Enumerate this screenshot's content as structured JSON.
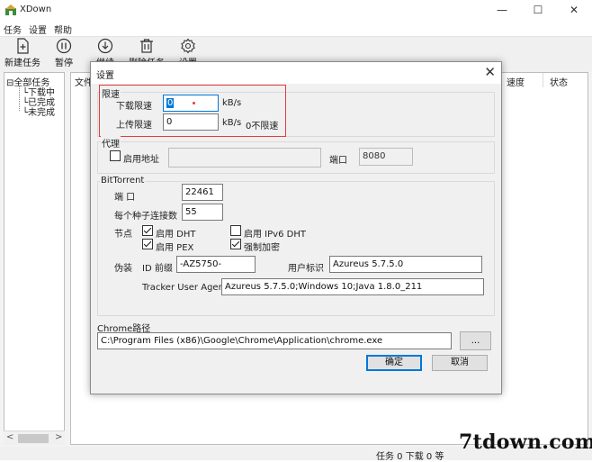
{
  "window": {
    "title": "XDown",
    "controls": {
      "minimize": "—",
      "maximize": "☐",
      "close": "✕"
    }
  },
  "menubar": {
    "items": [
      "任务",
      "设置",
      "帮助"
    ]
  },
  "toolbar": {
    "new_task": {
      "label": "新建任务",
      "icon": "add-file-icon"
    },
    "pause": {
      "label": "暂停",
      "icon": "pause-icon"
    },
    "resume": {
      "label": "继续",
      "icon": "download-icon"
    },
    "delete": {
      "label": "删除任务",
      "icon": "trash-icon"
    },
    "settings": {
      "label": "设置",
      "icon": "gear-icon"
    }
  },
  "tree": {
    "root": "全部任务",
    "children": [
      "下载中",
      "已完成",
      "未完成"
    ]
  },
  "list": {
    "columns": [
      "文件",
      "速度",
      "状态"
    ]
  },
  "statusbar": {
    "text": "任务 0 下载    0 等"
  },
  "watermark": "7tdown.com",
  "dialog": {
    "title": "设置",
    "speed_limit": {
      "group_label": "限速",
      "download_label": "下载限速",
      "download_value": "0",
      "upload_label": "上传限速",
      "upload_value": "0",
      "unit": "kB/s",
      "unit2": "kB/s",
      "no_limit_note": "0不限速"
    },
    "proxy": {
      "group_label": "代理",
      "enable_label": "启用地址",
      "enabled": false,
      "address_value": "",
      "port_label": "端口",
      "port_value": "8080"
    },
    "bittorrent": {
      "group_label": "BitTorrent",
      "port_label": "端  口",
      "port_value": "22461",
      "connections_label": "每个种子连接数",
      "connections_value": "55",
      "node_label": "节点",
      "dht_label": "启用 DHT",
      "dht_checked": true,
      "ipv6_dht_label": "启用 IPv6 DHT",
      "ipv6_dht_checked": false,
      "pex_label": "启用 PEX",
      "pex_checked": true,
      "encrypt_label": "强制加密",
      "encrypt_checked": true,
      "spoof_label": "伪装",
      "id_prefix_label": "ID 前缀",
      "id_prefix_value": "-AZ5750-",
      "user_agent_label": "用户标识",
      "user_agent_value": "Azureus 5.7.5.0",
      "tracker_ua_label": "Tracker User Agent",
      "tracker_ua_value": "Azureus 5.7.5.0;Windows 10;Java 1.8.0_211"
    },
    "chrome": {
      "label": "Chrome路径",
      "path_value": "C:\\Program Files (x86)\\Google\\Chrome\\Application\\chrome.exe",
      "browse_label": "..."
    },
    "ok_label": "确定",
    "cancel_label": "取消",
    "close_glyph": "✕"
  },
  "colors": {
    "highlight_border": "#e33b3b",
    "focus_blue": "#0078d7"
  }
}
